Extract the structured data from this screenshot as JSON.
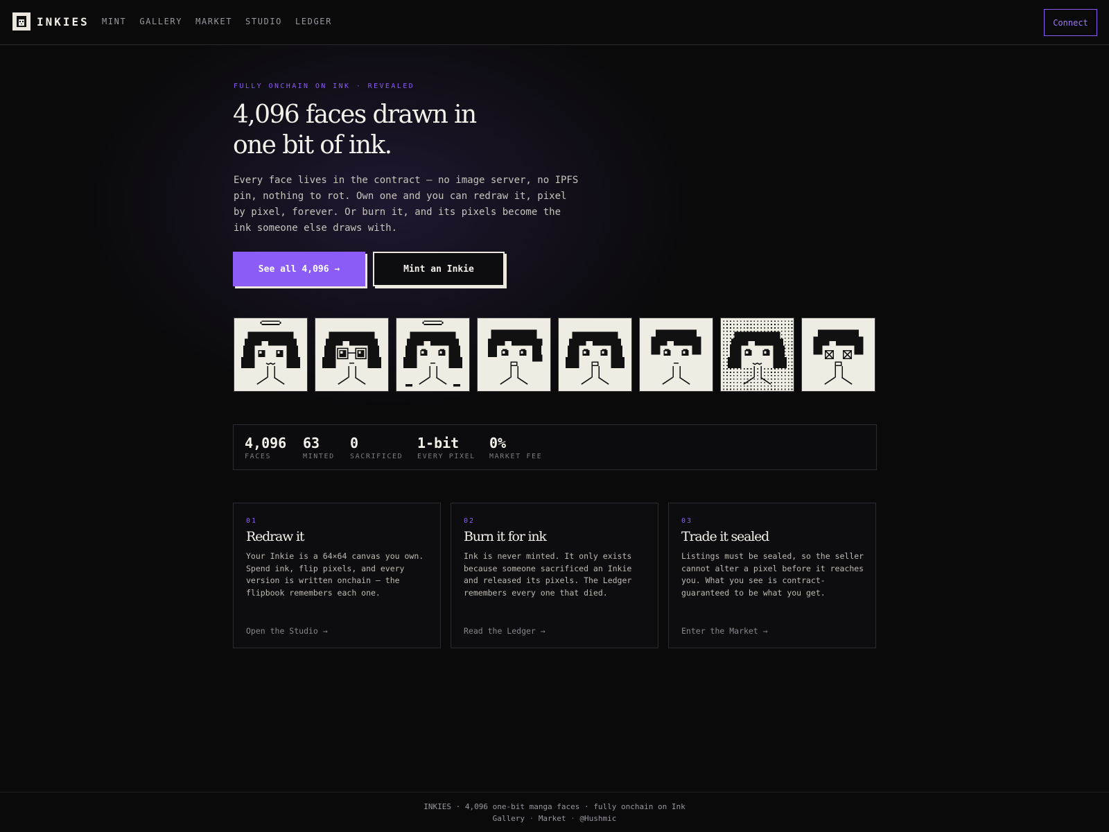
{
  "header": {
    "brand": "INKIES",
    "nav": [
      "MINT",
      "GALLERY",
      "MARKET",
      "STUDIO",
      "LEDGER"
    ],
    "connect_label": "Connect"
  },
  "hero": {
    "eyebrow": "FULLY ONCHAIN ON INK · REVEALED",
    "title_line1": "4,096 faces drawn in",
    "title_line2": "one bit of ink.",
    "lede": "Every face lives in the contract — no image server, no IPFS pin, nothing to rot. Own one and you can redraw it, pixel by pixel, forever. Or burn it, and its pixels become the ink someone else draws with.",
    "primary_button": "See all 4,096 →",
    "secondary_button": "Mint an Inkie"
  },
  "faces": [
    {
      "hair": "bob",
      "accessory": "halo",
      "eyes": "square",
      "mouth": "w"
    },
    {
      "hair": "bob",
      "accessory": "glasses",
      "eyes": "square",
      "mouth": "line"
    },
    {
      "hair": "bob",
      "accessory": "halo",
      "eyes": "round",
      "mouth": "line"
    },
    {
      "hair": "side",
      "accessory": "none",
      "eyes": "round",
      "mouth": "open"
    },
    {
      "hair": "bob",
      "accessory": "none",
      "eyes": "round",
      "mouth": "open"
    },
    {
      "hair": "short",
      "accessory": "none",
      "eyes": "round",
      "mouth": "line"
    },
    {
      "hair": "bob",
      "accessory": "dotted",
      "eyes": "round",
      "mouth": "w"
    },
    {
      "hair": "short",
      "accessory": "none",
      "eyes": "cross",
      "mouth": "open"
    }
  ],
  "stats": [
    {
      "value": "4,096",
      "label": "FACES"
    },
    {
      "value": "63",
      "label": "MINTED"
    },
    {
      "value": "0",
      "label": "SACRIFICED"
    },
    {
      "value": "1-bit",
      "label": "EVERY PIXEL"
    },
    {
      "value": "0%",
      "label": "MARKET FEE"
    }
  ],
  "cards": [
    {
      "num": "01",
      "title": "Redraw it",
      "body": "Your Inkie is a 64×64 canvas you own. Spend ink, flip pixels, and every version is written onchain — the flipbook remembers each one.",
      "link": "Open the Studio →"
    },
    {
      "num": "02",
      "title": "Burn it for ink",
      "body": "Ink is never minted. It only exists because someone sacrificed an Inkie and released its pixels. The Ledger remembers every one that died.",
      "link": "Read the Ledger →"
    },
    {
      "num": "03",
      "title": "Trade it sealed",
      "body": "Listings must be sealed, so the seller cannot alter a pixel before it reaches you. What you see is contract-guaranteed to be what you get.",
      "link": "Enter the Market →"
    }
  ],
  "footer": {
    "line1": "INKIES · 4,096 one-bit manga faces · fully onchain on Ink",
    "links": [
      "Gallery",
      "Market",
      "@Hushmic"
    ]
  },
  "colors": {
    "background": "#0a0a0b",
    "accent": "#8b5cf6",
    "paper": "#efece4",
    "ink": "#111111"
  }
}
